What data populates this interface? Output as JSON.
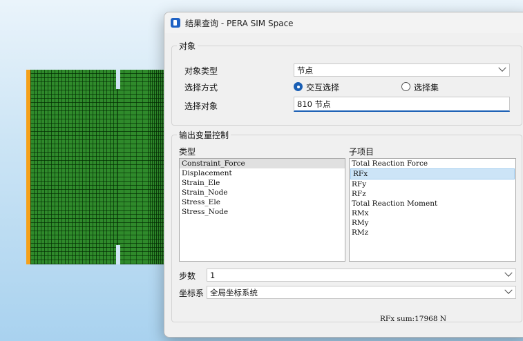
{
  "window": {
    "title": "结果查询 - PERA SIM Space"
  },
  "object_group": {
    "label": "对象",
    "object_type_label": "对象类型",
    "object_type_value": "节点",
    "select_mode_label": "选择方式",
    "radio_interactive": "交互选择",
    "radio_set": "选择集",
    "select_object_label": "选择对象",
    "select_object_value": "810 节点"
  },
  "output_group": {
    "label": "输出变量控制",
    "type_header": "类型",
    "types": [
      "Constraint_Force",
      "Displacement",
      "Strain_Ele",
      "Strain_Node",
      "Stress_Ele",
      "Stress_Node"
    ],
    "sub_header": "子项目",
    "subitems": [
      "Total Reaction Force",
      "RFx",
      "RFy",
      "RFz",
      "Total Reaction Moment",
      "RMx",
      "RMy",
      "RMz"
    ],
    "step_label": "步数",
    "step_value": "1",
    "coord_label": "坐标系",
    "coord_value": "全局坐标系统"
  },
  "status": {
    "text": "RFx sum:17968 N"
  },
  "colors": {
    "accent": "#1a5fb4",
    "mesh": "#2f8a2b",
    "edge": "#f5a11a"
  }
}
